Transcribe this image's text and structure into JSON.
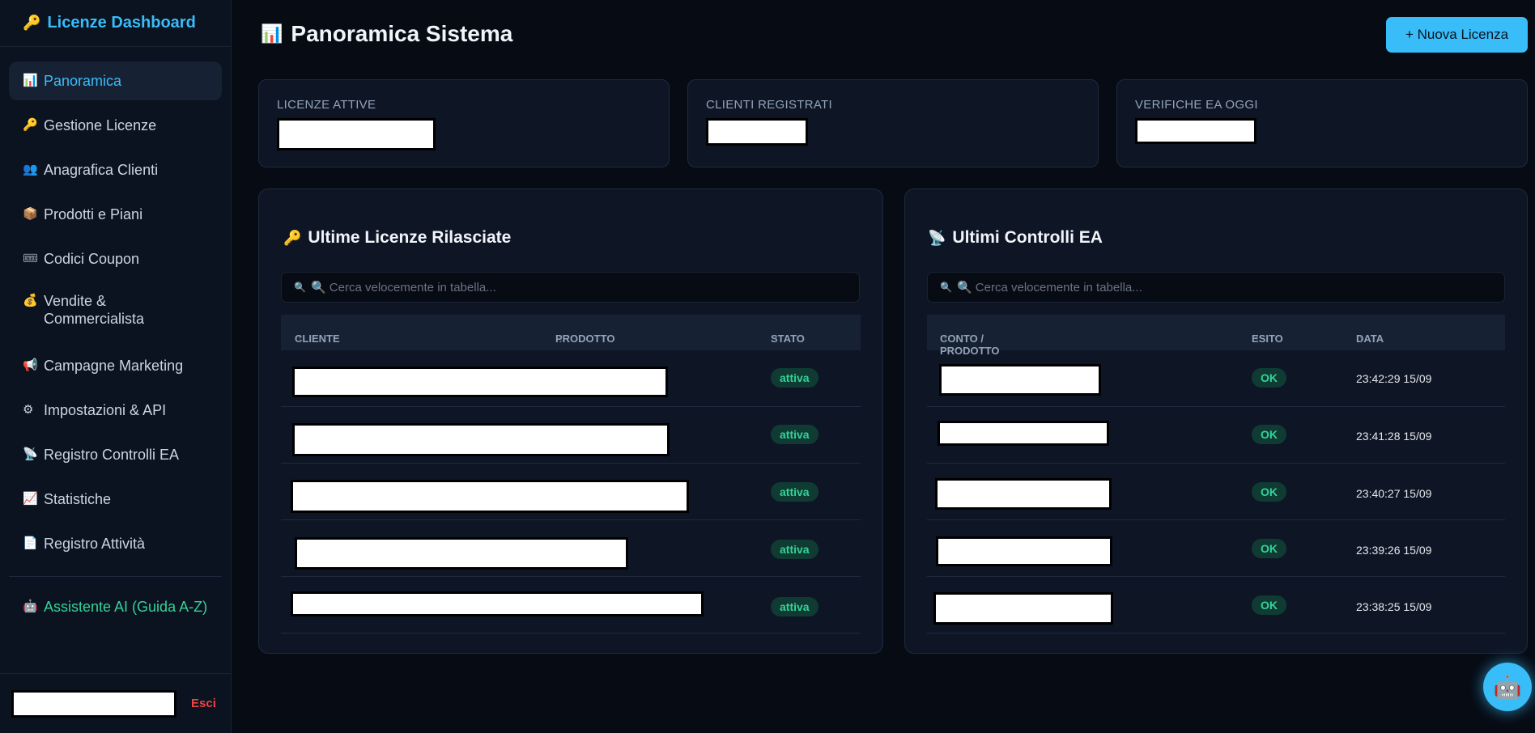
{
  "brand": {
    "icon": "key-icon",
    "glyph": "🔑",
    "title": "Licenze Dashboard"
  },
  "sidebar": {
    "items": [
      {
        "glyph": "📊",
        "icon": "chart-icon",
        "label": "Panoramica",
        "active": true
      },
      {
        "glyph": "🔑",
        "icon": "key-icon",
        "label": "Gestione Licenze"
      },
      {
        "glyph": "👥",
        "icon": "users-icon",
        "label": "Anagrafica Clienti"
      },
      {
        "glyph": "📦",
        "icon": "box-icon",
        "label": "Prodotti e Piani"
      },
      {
        "glyph": "🎟",
        "icon": "ticket-icon",
        "label": "Codici Coupon"
      },
      {
        "glyph": "💰",
        "icon": "money-bag-icon",
        "label": "Vendite & Commercialista"
      },
      {
        "glyph": "📢",
        "icon": "megaphone-icon",
        "label": "Campagne Marketing"
      },
      {
        "glyph": "⚙",
        "icon": "gear-icon",
        "label": "Impostazioni & API"
      },
      {
        "glyph": "📡",
        "icon": "satellite-icon",
        "label": "Registro Controlli EA"
      },
      {
        "glyph": "📈",
        "icon": "trend-up-icon",
        "label": "Statistiche"
      },
      {
        "glyph": "📄",
        "icon": "document-icon",
        "label": "Registro Attività"
      }
    ],
    "assistant": {
      "glyph": "🤖",
      "icon": "robot-icon",
      "label": "Assistente AI (Guida A-Z)"
    },
    "logout": "Esci"
  },
  "header": {
    "glyph": "📊",
    "icon": "chart-icon",
    "title": "Panoramica Sistema",
    "new_button": "+ Nuova Licenza"
  },
  "stats": [
    {
      "label": "LICENZE ATTIVE"
    },
    {
      "label": "CLIENTI REGISTRATI"
    },
    {
      "label": "VERIFICHE EA OGGI"
    }
  ],
  "licenses_panel": {
    "glyph": "🔑",
    "title": "Ultime Licenze Rilasciate",
    "search_placeholder": "🔍 Cerca velocemente in tabella...",
    "columns": [
      "CLIENTE",
      "PRODOTTO",
      "STATO"
    ],
    "sort_glyph": "↕",
    "rows": [
      {
        "status": "attiva"
      },
      {
        "status": "attiva"
      },
      {
        "status": "attiva"
      },
      {
        "status": "attiva"
      },
      {
        "status": "attiva"
      }
    ]
  },
  "checks_panel": {
    "glyph": "📡",
    "title": "Ultimi Controlli EA",
    "search_placeholder": "🔍 Cerca velocemente in tabella...",
    "columns": [
      "CONTO / PRODOTTO",
      "ESITO",
      "DATA"
    ],
    "rows": [
      {
        "result": "OK",
        "date": "23:42:29 15/09"
      },
      {
        "result": "OK",
        "date": "23:41:28 15/09"
      },
      {
        "result": "OK",
        "date": "23:40:27 15/09"
      },
      {
        "result": "OK",
        "date": "23:39:26 15/09"
      },
      {
        "result": "OK",
        "date": "23:38:25 15/09"
      }
    ]
  },
  "assistant_fab": {
    "glyph": "🤖",
    "icon": "robot-icon"
  },
  "colors": {
    "accent": "#38bdf8",
    "success": "#34d399",
    "danger": "#ef4444",
    "background": "#070b14"
  }
}
